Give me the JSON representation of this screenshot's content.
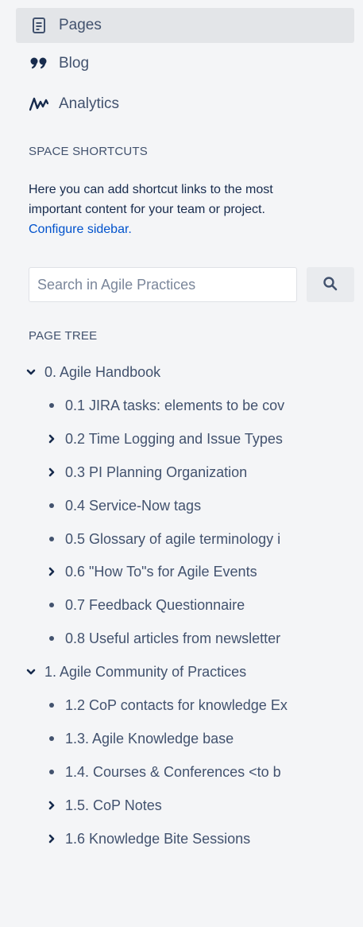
{
  "nav": {
    "items": [
      {
        "label": "Pages",
        "icon": "pages-icon",
        "active": true
      },
      {
        "label": "Blog",
        "icon": "blog-quote-icon",
        "active": false
      },
      {
        "label": "Analytics",
        "icon": "analytics-icon",
        "active": false
      }
    ]
  },
  "shortcuts": {
    "heading": "SPACE SHORTCUTS",
    "text_line1": "Here you can add shortcut links to the most",
    "text_line2": "important content for your team or project.",
    "link": "Configure sidebar."
  },
  "search": {
    "placeholder": "Search in Agile Practices",
    "value": "",
    "button_icon": "search-icon"
  },
  "page_tree": {
    "heading": "PAGE TREE",
    "items": [
      {
        "label": "0. Agile Handbook",
        "level": 0,
        "state": "expanded"
      },
      {
        "label": "0.1 JIRA tasks: elements to be cov",
        "level": 1,
        "state": "leaf"
      },
      {
        "label": "0.2 Time Logging and Issue Types",
        "level": 1,
        "state": "collapsed"
      },
      {
        "label": "0.3 PI Planning Organization",
        "level": 1,
        "state": "collapsed"
      },
      {
        "label": "0.4 Service-Now tags",
        "level": 1,
        "state": "leaf"
      },
      {
        "label": "0.5 Glossary of agile terminology i",
        "level": 1,
        "state": "leaf"
      },
      {
        "label": "0.6 \"How To\"s for Agile Events",
        "level": 1,
        "state": "collapsed"
      },
      {
        "label": "0.7 Feedback Questionnaire",
        "level": 1,
        "state": "leaf"
      },
      {
        "label": "0.8 Useful articles from newsletter",
        "level": 1,
        "state": "leaf"
      },
      {
        "label": "1. Agile Community of Practices",
        "level": 0,
        "state": "expanded"
      },
      {
        "label": "1.2 CoP contacts for knowledge Ex",
        "level": 1,
        "state": "leaf"
      },
      {
        "label": "1.3. Agile Knowledge base",
        "level": 1,
        "state": "leaf"
      },
      {
        "label": "1.4. Courses & Conferences <to b",
        "level": 1,
        "state": "leaf"
      },
      {
        "label": "1.5. CoP Notes",
        "level": 1,
        "state": "collapsed"
      },
      {
        "label": "1.6 Knowledge Bite Sessions",
        "level": 1,
        "state": "collapsed"
      }
    ]
  },
  "colors": {
    "sidebar_bg": "#f4f5f7",
    "active_bg": "#e3e5e8",
    "text": "#42526e",
    "link": "#0052cc"
  }
}
